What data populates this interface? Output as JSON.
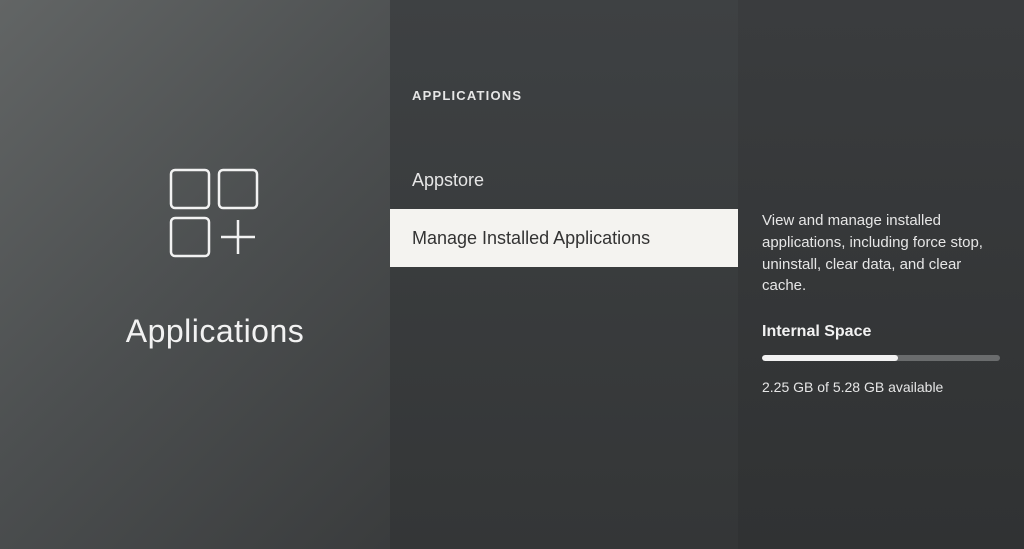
{
  "left": {
    "title": "Applications"
  },
  "middle": {
    "header": "APPLICATIONS",
    "items": [
      {
        "label": "Appstore",
        "selected": false
      },
      {
        "label": "Manage Installed Applications",
        "selected": true
      }
    ]
  },
  "right": {
    "description": "View and manage installed applications, including force stop, uninstall, clear data, and clear cache.",
    "space_label": "Internal Space",
    "space_used_gb": 2.25,
    "space_total_gb": 5.28,
    "space_detail": "2.25 GB of 5.28 GB available",
    "progress_percent": 57
  }
}
